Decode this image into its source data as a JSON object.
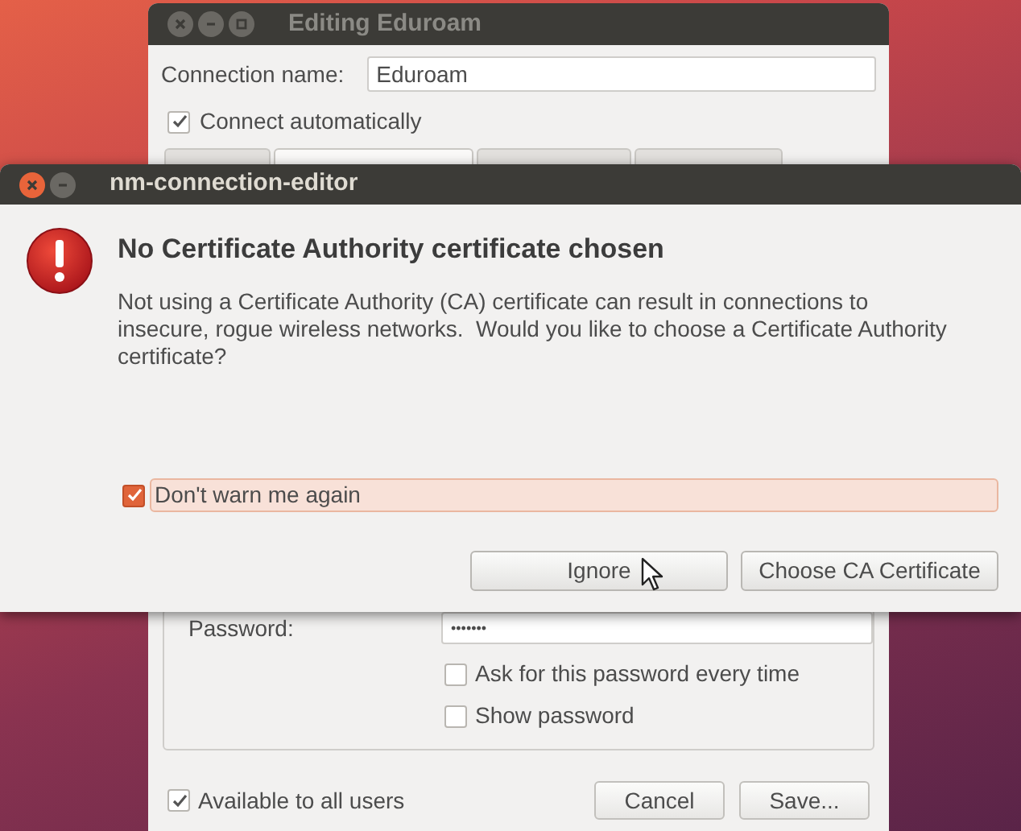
{
  "background_window": {
    "title": "Editing Eduroam",
    "connection_name": {
      "label": "Connection name:",
      "value": "Eduroam"
    },
    "connect_automatically": {
      "label": "Connect automatically",
      "checked": true
    },
    "tabs": [
      {
        "selected": false
      },
      {
        "selected": true
      },
      {
        "selected": false
      },
      {
        "selected": false
      }
    ],
    "password": {
      "label": "Password:",
      "value": "•••••••"
    },
    "options": [
      {
        "label": "Ask for this password every time",
        "checked": false
      },
      {
        "label": "Show password",
        "checked": false
      }
    ],
    "available_to_all_users": {
      "label": "Available to all users",
      "checked": true
    },
    "buttons": [
      "Cancel",
      "Save..."
    ]
  },
  "dialog": {
    "title": "nm-connection-editor",
    "heading": "No Certificate Authority certificate chosen",
    "message": "Not using a Certificate Authority (CA) certificate can result in connections to insecure, rogue wireless networks.  Would you like to choose a Certificate Authority certificate?",
    "dont_warn": {
      "label": "Don't warn me again",
      "checked": true
    },
    "buttons": [
      "Ignore",
      "Choose CA Certificate"
    ]
  }
}
